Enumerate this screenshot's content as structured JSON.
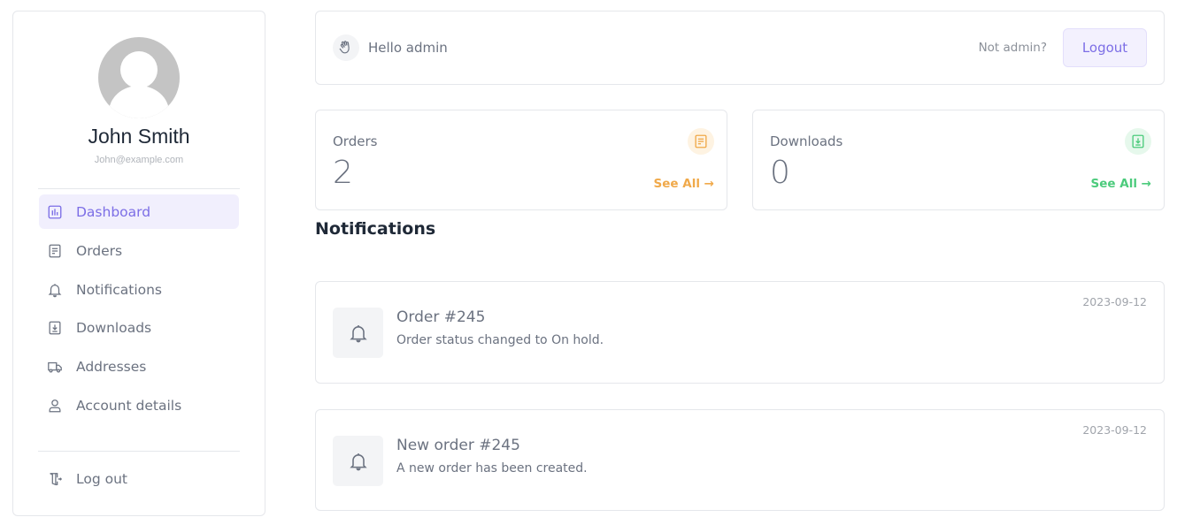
{
  "profile": {
    "name": "John Smith",
    "email": "John@example.com"
  },
  "sidebar": {
    "items": [
      {
        "label": "Dashboard",
        "icon": "chart-icon",
        "active": true
      },
      {
        "label": "Orders",
        "icon": "document-icon"
      },
      {
        "label": "Notifications",
        "icon": "bell-icon"
      },
      {
        "label": "Downloads",
        "icon": "download-icon"
      },
      {
        "label": "Addresses",
        "icon": "truck-icon"
      },
      {
        "label": "Account details",
        "icon": "user-icon"
      }
    ],
    "logout": {
      "label": "Log out",
      "icon": "door-exit-icon"
    }
  },
  "greeting": {
    "text": "Hello admin",
    "icon": "waving-hand-icon",
    "not_admin": "Not admin?",
    "logout_label": "Logout"
  },
  "stats": [
    {
      "label": "Orders",
      "value": "2",
      "link": "See All →",
      "icon": "document-icon",
      "color": "#f0a94a",
      "bg": "#fef3e2"
    },
    {
      "label": "Downloads",
      "value": "0",
      "link": "See All →",
      "icon": "download-icon",
      "color": "#4ccb7c",
      "bg": "#e6f8ec"
    }
  ],
  "notifications": {
    "title": "Notifications",
    "items": [
      {
        "title": "Order #245",
        "description": "Order status changed to On hold.",
        "date": "2023-09-12"
      },
      {
        "title": "New order #245",
        "description": "A new order has been created.",
        "date": "2023-09-12"
      }
    ]
  },
  "colors": {
    "accent": "#7c6ee6",
    "accent_bg": "#f1effd",
    "border": "#e5e7eb"
  }
}
